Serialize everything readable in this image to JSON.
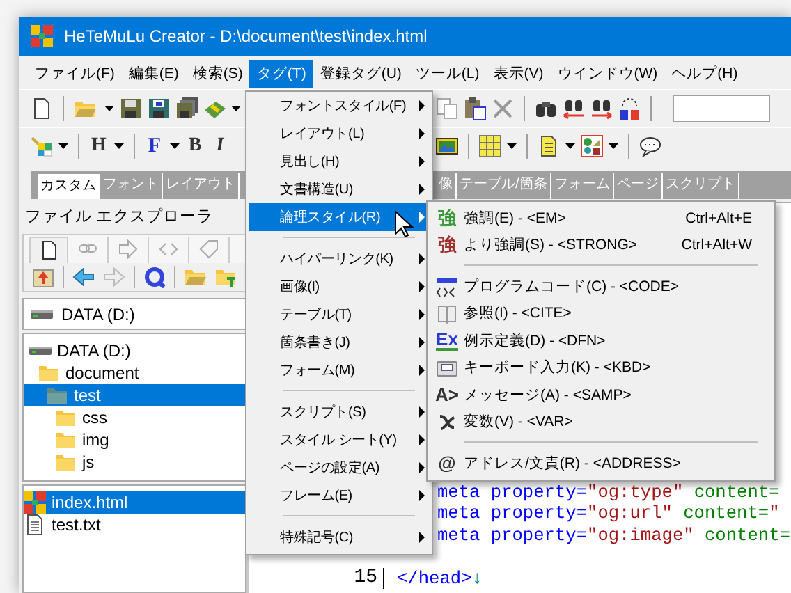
{
  "window": {
    "title": "HeTeMuLu Creator - D:\\document\\test\\index.html"
  },
  "menu_bar": [
    {
      "label": "ファイル(F)",
      "selected": false
    },
    {
      "label": "編集(E)",
      "selected": false
    },
    {
      "label": "検索(S)",
      "selected": false
    },
    {
      "label": "タグ(T)",
      "selected": true
    },
    {
      "label": "登録タグ(U)",
      "selected": false
    },
    {
      "label": "ツール(L)",
      "selected": false
    },
    {
      "label": "表示(V)",
      "selected": false
    },
    {
      "label": "ウインドウ(W)",
      "selected": false
    },
    {
      "label": "ヘルプ(H)",
      "selected": false
    }
  ],
  "format_toolbar": [
    {
      "label": "H",
      "dropdown": true
    },
    {
      "label": "F",
      "dropdown": true
    },
    {
      "label": "B",
      "dropdown": false
    },
    {
      "label": "I",
      "dropdown": false
    }
  ],
  "toolbar_tabs": [
    {
      "label": "カスタム",
      "selected": true
    },
    {
      "label": "フォント",
      "selected": false
    },
    {
      "label": "レイアウト",
      "selected": false
    },
    {
      "label": "像",
      "selected": false
    },
    {
      "label": "テーブル/箇条",
      "selected": false
    },
    {
      "label": "フォーム",
      "selected": false
    },
    {
      "label": "ページ",
      "selected": false
    },
    {
      "label": "スクリプト",
      "selected": false
    }
  ],
  "file_explorer": {
    "title": "ファイル エクスプローラ",
    "drive": "DATA (D:)",
    "tree": [
      {
        "kind": "drive",
        "label": "DATA (D:)",
        "selected": false,
        "children": [
          {
            "kind": "folder",
            "label": "document",
            "selected": false,
            "children": [
              {
                "kind": "folder",
                "label": "test",
                "selected": true,
                "children": [
                  {
                    "kind": "folder",
                    "label": "css",
                    "selected": false
                  },
                  {
                    "kind": "folder",
                    "label": "img",
                    "selected": false
                  },
                  {
                    "kind": "folder",
                    "label": "js",
                    "selected": false
                  }
                ]
              }
            ]
          }
        ]
      }
    ],
    "files": [
      {
        "kind": "html",
        "label": "index.html",
        "selected": true
      },
      {
        "kind": "text",
        "label": "test.txt",
        "selected": false
      }
    ]
  },
  "editor": {
    "lines": [
      {
        "kind": "partial",
        "segments": [
          {
            "text": "meta property=",
            "kind": "name"
          },
          {
            "text": "\"og:type\"",
            "kind": "value"
          },
          {
            "text": " content=",
            "kind": "attr"
          }
        ]
      },
      {
        "kind": "partial",
        "segments": [
          {
            "text": "meta property=",
            "kind": "name"
          },
          {
            "text": "\"og:url\"",
            "kind": "value"
          },
          {
            "text": " content=",
            "kind": "attr"
          },
          {
            "text": "\"",
            "kind": "value"
          }
        ]
      },
      {
        "kind": "partial",
        "segments": [
          {
            "text": "meta property=",
            "kind": "name"
          },
          {
            "text": "\"og:image\"",
            "kind": "value"
          },
          {
            "text": " content=",
            "kind": "attr"
          }
        ]
      },
      {
        "kind": "full",
        "number": "15",
        "segments": [
          {
            "text": "</head>",
            "kind": "name"
          },
          {
            "text": "↓",
            "kind": "eol"
          }
        ]
      }
    ]
  },
  "tag_menu": {
    "items": [
      {
        "kind": "item",
        "label": "フォントスタイル(F)",
        "selected": false,
        "has_submenu": true
      },
      {
        "kind": "item",
        "label": "レイアウト(L)",
        "selected": false,
        "has_submenu": true
      },
      {
        "kind": "item",
        "label": "見出し(H)",
        "selected": false,
        "has_submenu": true
      },
      {
        "kind": "item",
        "label": "文書構造(U)",
        "selected": false,
        "has_submenu": true
      },
      {
        "kind": "item",
        "label": "論理スタイル(R)",
        "selected": true,
        "has_submenu": true
      },
      {
        "kind": "separator"
      },
      {
        "kind": "item",
        "label": "ハイパーリンク(K)",
        "selected": false,
        "has_submenu": true
      },
      {
        "kind": "item",
        "label": "画像(I)",
        "selected": false,
        "has_submenu": true
      },
      {
        "kind": "item",
        "label": "テーブル(T)",
        "selected": false,
        "has_submenu": true
      },
      {
        "kind": "item",
        "label": "箇条書き(J)",
        "selected": false,
        "has_submenu": true
      },
      {
        "kind": "item",
        "label": "フォーム(M)",
        "selected": false,
        "has_submenu": true
      },
      {
        "kind": "separator"
      },
      {
        "kind": "item",
        "label": "スクリプト(S)",
        "selected": false,
        "has_submenu": true
      },
      {
        "kind": "item",
        "label": "スタイル シート(Y)",
        "selected": false,
        "has_submenu": true
      },
      {
        "kind": "item",
        "label": "ページの設定(A)",
        "selected": false,
        "has_submenu": true
      },
      {
        "kind": "item",
        "label": "フレーム(E)",
        "selected": false,
        "has_submenu": true
      },
      {
        "kind": "separator"
      },
      {
        "kind": "item",
        "label": "特殊記号(C)",
        "selected": false,
        "has_submenu": true
      }
    ]
  },
  "logic_style_submenu": {
    "items": [
      {
        "kind": "item",
        "icon_text": "強",
        "label": "強調(E) - <EM>",
        "shortcut": "Ctrl+Alt+E"
      },
      {
        "kind": "item",
        "icon_text": "強",
        "label": "より強調(S) - <STRONG>",
        "shortcut": "Ctrl+Alt+W"
      },
      {
        "kind": "separator"
      },
      {
        "kind": "item",
        "label": "プログラムコード(C) - <CODE>"
      },
      {
        "kind": "item",
        "label": "参照(I) - <CITE>"
      },
      {
        "kind": "item",
        "icon_text": "Ex",
        "label": "例示定義(D) - <DFN>"
      },
      {
        "kind": "item",
        "label": "キーボード入力(K) - <KBD>"
      },
      {
        "kind": "item",
        "icon_text": "A>",
        "label": "メッセージ(A) - <SAMP>"
      },
      {
        "kind": "item",
        "label": "変数(V) - <VAR>"
      },
      {
        "kind": "separator"
      },
      {
        "kind": "item",
        "icon_text": "@",
        "label": "アドレス/文責(R) - <ADDRESS>"
      }
    ]
  }
}
